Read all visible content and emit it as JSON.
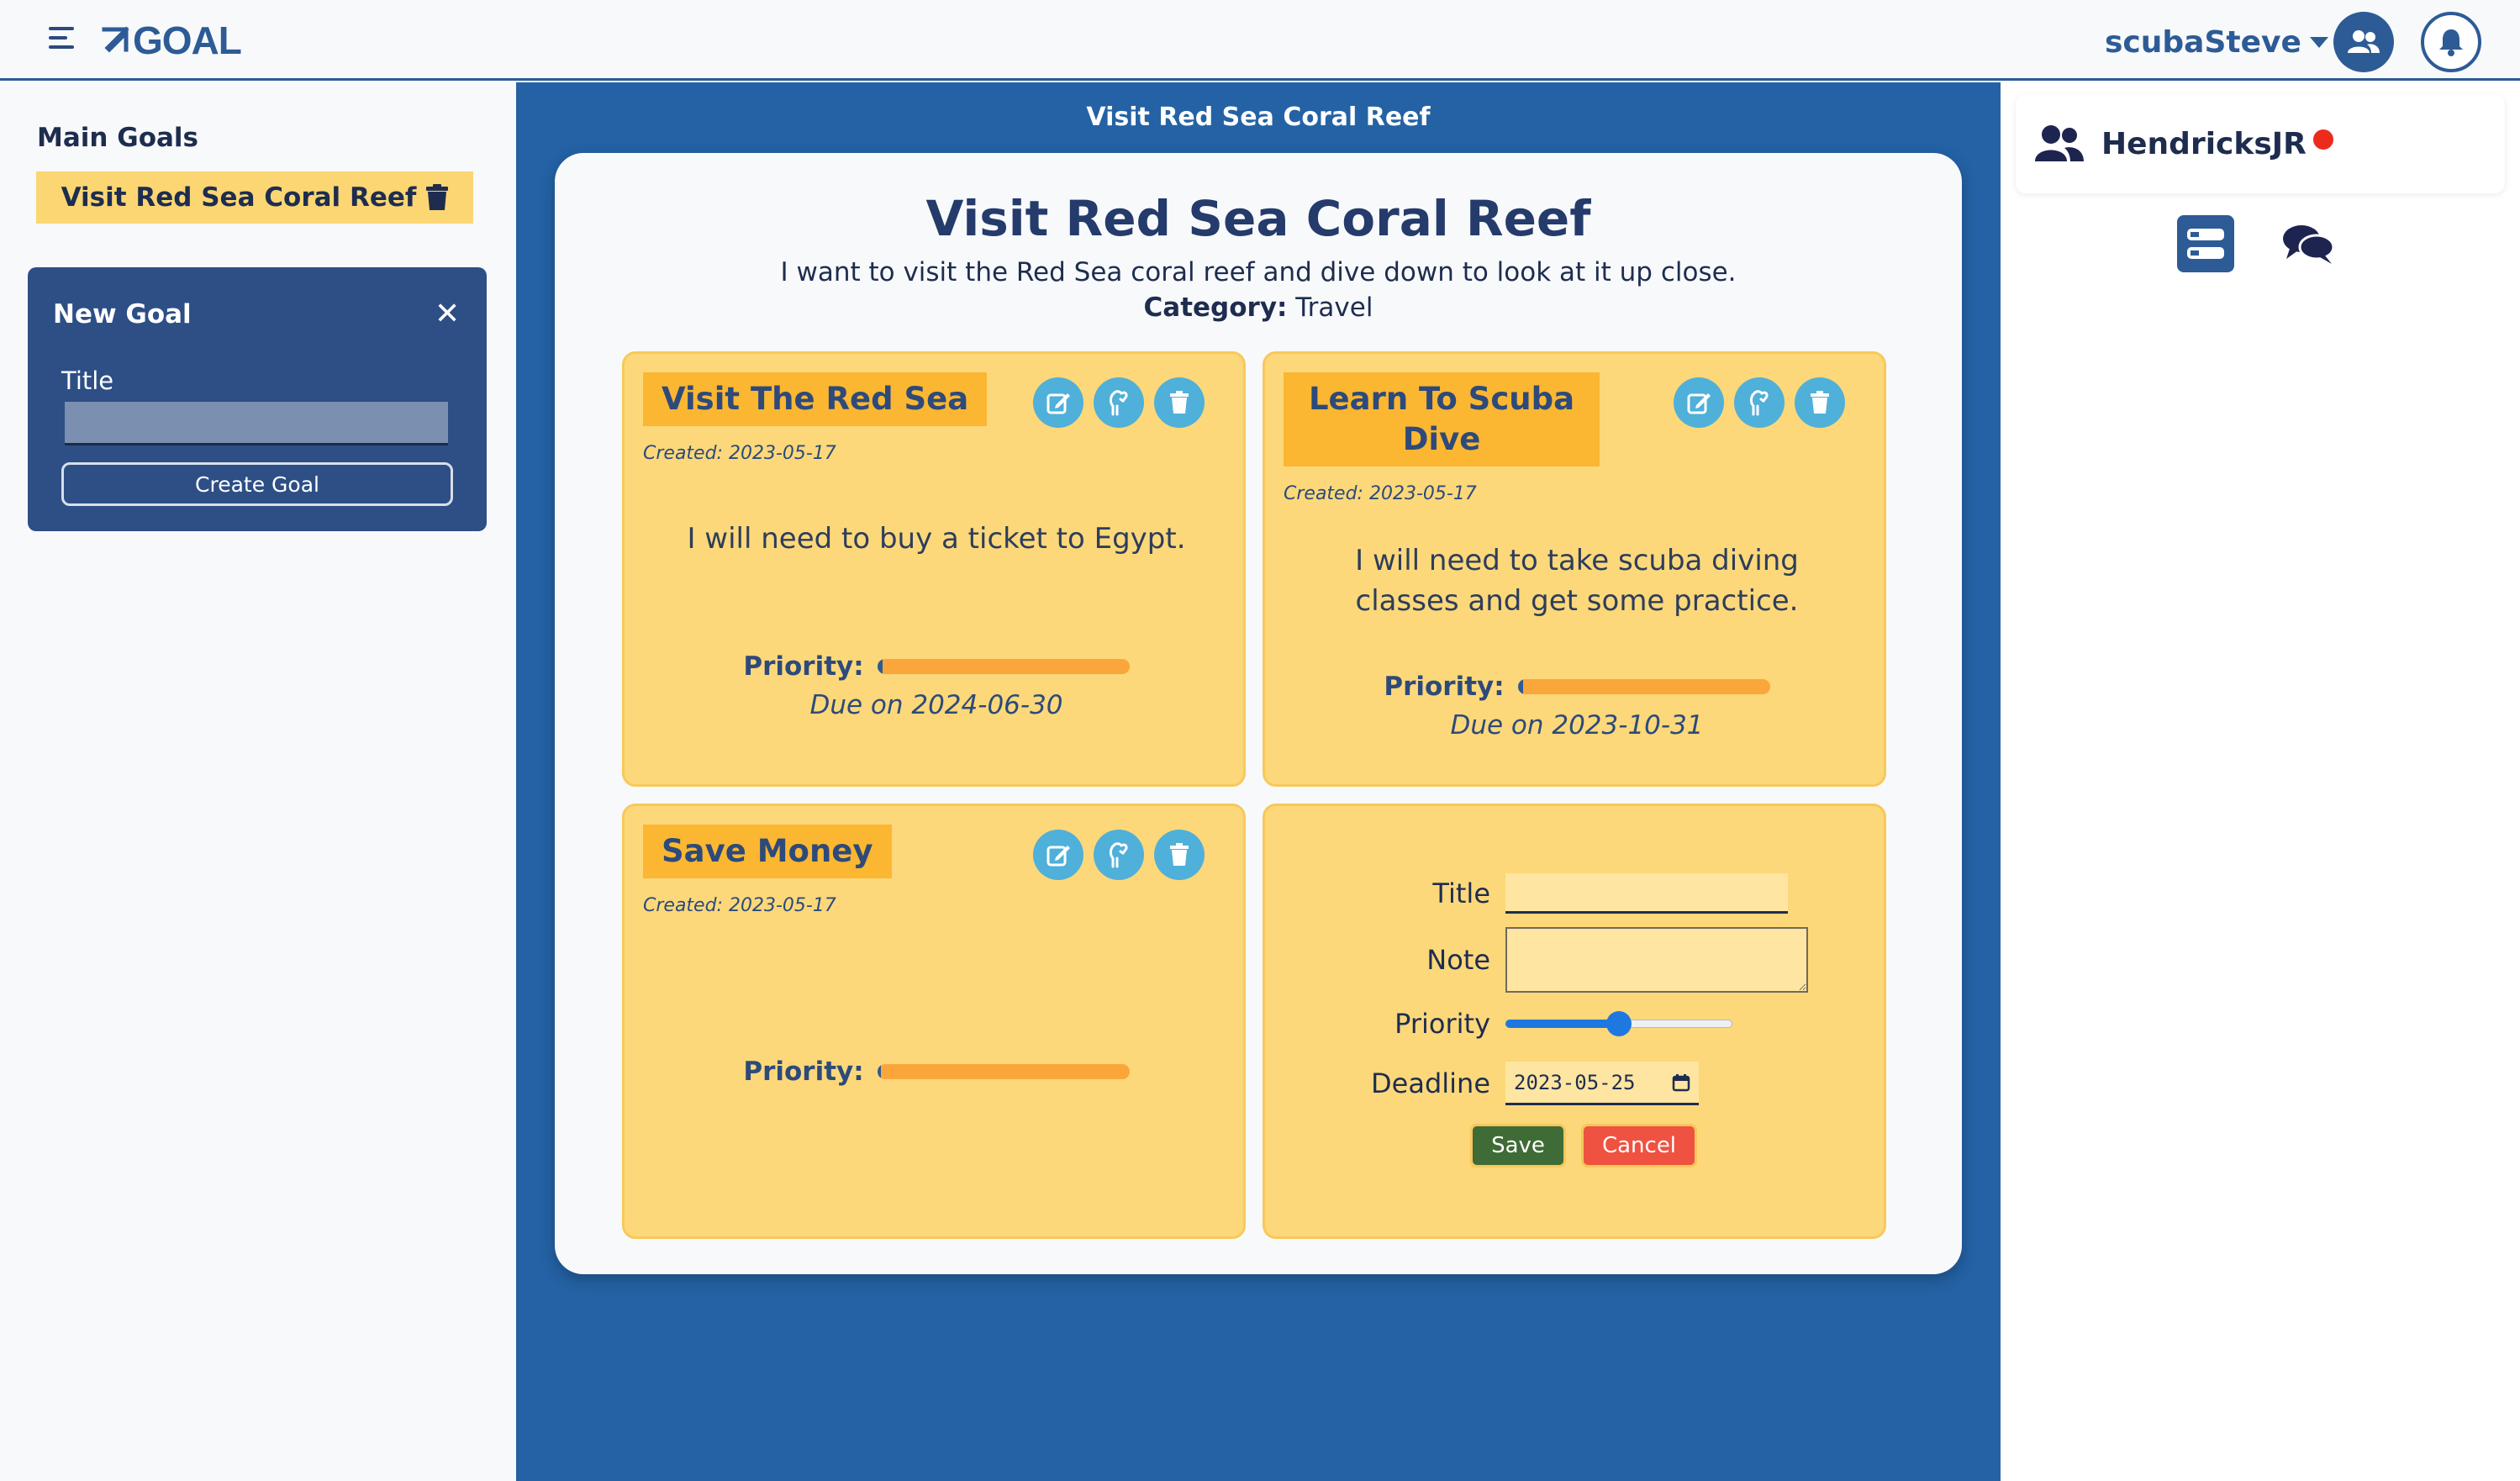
{
  "header": {
    "logo_text": "GOAL",
    "username": "scubaSteve"
  },
  "sidebar_left": {
    "section_label": "Main Goals",
    "main_goals": [
      {
        "label": "Visit Red Sea Coral Reef"
      }
    ],
    "new_goal_panel": {
      "title": "New Goal",
      "close_label": "✕",
      "field_label": "Title",
      "field_value": "",
      "create_button": "Create Goal"
    }
  },
  "main": {
    "page_heading": "Visit Red Sea Coral Reef",
    "goal": {
      "title": "Visit Red Sea Coral Reef",
      "description": "I want to visit the Red Sea coral reef and dive down to look at it up close.",
      "category_label": "Category:",
      "category_value": "Travel"
    },
    "tasks": [
      {
        "title": "Visit The Red Sea",
        "created": "Created: 2023-05-17",
        "note": "I will need to buy a ticket to Egypt.",
        "priority_label": "Priority:",
        "priority_value": 0.02,
        "due": "Due on 2024-06-30"
      },
      {
        "title": "Learn To Scuba Dive",
        "created": "Created: 2023-05-17",
        "note": "I will need to take scuba diving classes and get some practice.",
        "priority_label": "Priority:",
        "priority_value": 0.02,
        "due": "Due on 2023-10-31"
      },
      {
        "title": "Save Money",
        "created": "Created: 2023-05-17",
        "note": "",
        "priority_label": "Priority:",
        "priority_value": 0.01,
        "due": ""
      }
    ],
    "new_task_form": {
      "title_label": "Title",
      "title_value": "",
      "note_label": "Note",
      "note_value": "",
      "priority_label": "Priority",
      "priority_value": 0.5,
      "deadline_label": "Deadline",
      "deadline_value": "2023-05-25",
      "save_label": "Save",
      "cancel_label": "Cancel"
    }
  },
  "sidebar_right": {
    "friend": {
      "name": "HendricksJR",
      "status": "offline"
    }
  },
  "colors": {
    "brand_blue": "#2d5b96",
    "main_background": "#2462a5",
    "task_card": "#fcd87a",
    "task_title_bg": "#fbb632",
    "priority_bar": "#fba63a",
    "action_icon_bg": "#4fb0d9",
    "save_button": "#3f6b36",
    "cancel_button": "#ef5240",
    "status_red": "#ec2b1c"
  },
  "icons": {
    "menu": "hamburger-icon",
    "logo": "double-arrow-icon",
    "friends": "users-icon",
    "notifications": "bell-icon",
    "delete_goal": "trash-icon",
    "task_edit": "edit-icon",
    "task_complete": "fist-icon",
    "task_delete": "trash-icon",
    "friends_panel": "users-icon",
    "tab_list": "list-icon",
    "tab_chat": "chat-icon"
  }
}
